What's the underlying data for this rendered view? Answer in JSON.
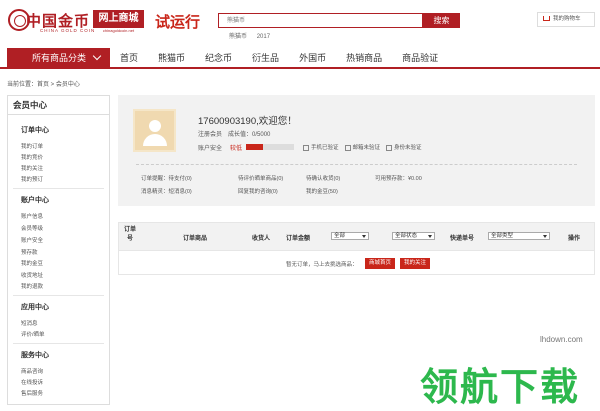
{
  "header": {
    "logo_cn": "中国金币",
    "logo_en": "CHINA GOLD COIN",
    "badge": "网上商城",
    "badge_sub": "chinagoldcoin.net",
    "trial": "试运行",
    "search_placeholder": "熊猫币",
    "search_button": "搜索",
    "hot_words": [
      "熊猫币",
      "2017"
    ],
    "cart": "我的购物车"
  },
  "nav": {
    "all_categories": "所有商品分类",
    "items": [
      "首页",
      "熊猫币",
      "纪念币",
      "衍生品",
      "外国币",
      "热销商品",
      "商品验证"
    ]
  },
  "breadcrumb": "当前位置：首页 > 会员中心",
  "sidebar": {
    "title": "会员中心",
    "sections": [
      {
        "title": "订单中心",
        "items": [
          "我的订单",
          "我的竞价",
          "我的关注",
          "我的预订"
        ]
      },
      {
        "title": "账户中心",
        "items": [
          "账户信息",
          "会员等级",
          "账户安全",
          "预存款",
          "我的金豆",
          "收货地址",
          "我的退款"
        ]
      },
      {
        "title": "应用中心",
        "items": [
          "短消息",
          "评价/晒单"
        ]
      },
      {
        "title": "服务中心",
        "items": [
          "商品咨询",
          "在线投诉",
          "售后服务"
        ]
      }
    ]
  },
  "profile": {
    "welcome": "17600903190,欢迎您！",
    "member_type": "注册会员",
    "growth": "成长值：0/5000",
    "safety_label": "账户安全",
    "safety_level": "较低",
    "safety_fraction": 0.35,
    "verifications": [
      "手机已验证",
      "邮箱未验证",
      "身份未验证"
    ],
    "stats_row1": [
      "订单提醒：待支付(0)",
      "待评价晒单商品(0)",
      "待确认收货(0)",
      "可用预存款：¥0.00"
    ],
    "stats_row2": [
      "消息精灵：短消息(0)",
      "回复我的咨询(0)",
      "我的金豆(50)"
    ]
  },
  "orders": {
    "columns": [
      "订单号",
      "订单商品",
      "收货人",
      "订单金额",
      "",
      "",
      "快递单号",
      "",
      "操作"
    ],
    "filters": [
      "全部",
      "全部状态",
      "全部类型"
    ],
    "empty_text": "暂无订单，马上去挑选商品：",
    "btn_mall": "商城首页",
    "btn_follow": "我的关注"
  },
  "watermark": {
    "text": "领航下载",
    "url": "lhdown.com"
  },
  "colors": {
    "brand": "#b01f24",
    "accent": "#c9261a",
    "watermark": "#2db84d"
  }
}
